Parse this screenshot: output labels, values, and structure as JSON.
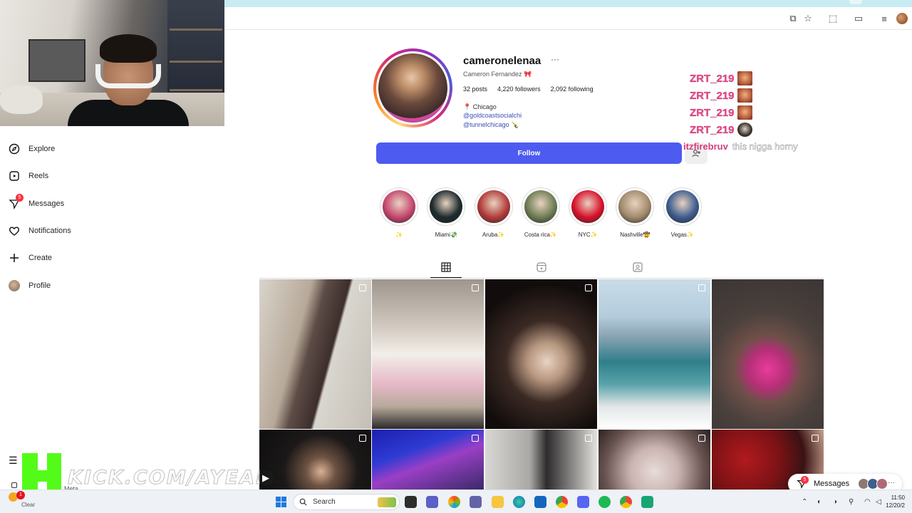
{
  "profile": {
    "username": "cameronelenaa",
    "full_name": "Cameron Fernandez 🎀",
    "stats": {
      "posts": "32 posts",
      "followers": "4,220 followers",
      "following": "2,092 following"
    },
    "bio": {
      "location": "📍 Chicago",
      "link1": "@goldcoastsocialchi",
      "link2": "@tunnelchicago 🍾"
    },
    "follow_label": "Follow"
  },
  "sidebar": {
    "items": [
      {
        "label": "Explore",
        "icon": "compass-icon"
      },
      {
        "label": "Reels",
        "icon": "reels-icon"
      },
      {
        "label": "Messages",
        "icon": "messenger-icon",
        "badge": "5"
      },
      {
        "label": "Notifications",
        "icon": "heart-icon"
      },
      {
        "label": "Create",
        "icon": "plus-icon"
      },
      {
        "label": "Profile",
        "icon": "profile-avatar"
      }
    ],
    "meta_text": "Meta"
  },
  "highlights": [
    {
      "label": "✨",
      "color": "#c5486f"
    },
    {
      "label": "Miami💸",
      "color": "#1d2a2e"
    },
    {
      "label": "Aruba✨",
      "color": "#b23c3a"
    },
    {
      "label": "Costa rica✨",
      "color": "#6e7d55"
    },
    {
      "label": "NYC✨",
      "color": "#d8122c"
    },
    {
      "label": "Nashville🤠",
      "color": "#a18a6c"
    },
    {
      "label": "Vegas✨",
      "color": "#3d5d8e"
    }
  ],
  "chat": {
    "lines": [
      {
        "user": "ZRT_219"
      },
      {
        "user": "ZRT_219"
      },
      {
        "user": "ZRT_219"
      },
      {
        "user": "ZRT_219"
      }
    ],
    "last_user": "itzfirebruv",
    "last_message": "this nigga horny"
  },
  "overlay": {
    "kick_url": "KICK.COM/AYEABE"
  },
  "messages_pill": {
    "label": "Messages",
    "badge": "5"
  },
  "taskbar": {
    "search_label": "Search",
    "notification_count": "1",
    "weather_label": "Clear",
    "time": "11:50",
    "date": "12/20/2"
  }
}
